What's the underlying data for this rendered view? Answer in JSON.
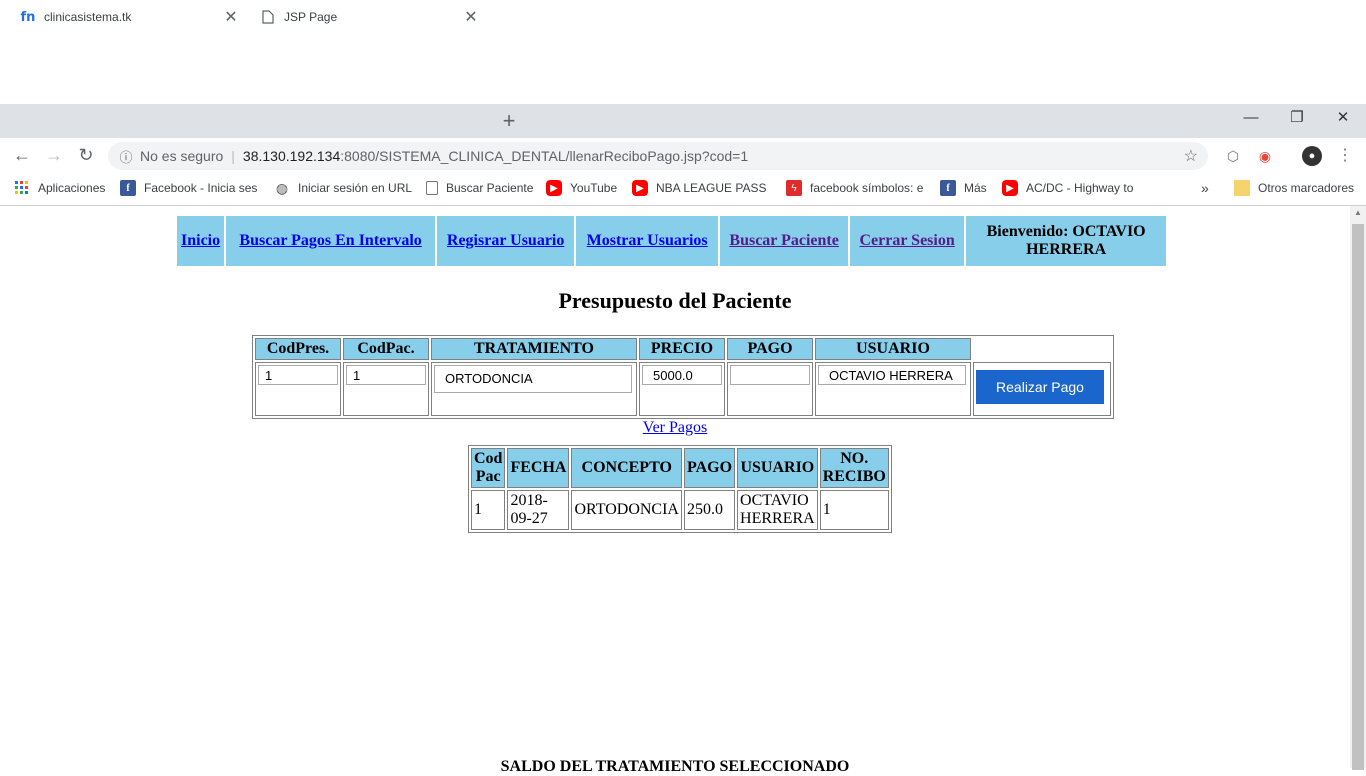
{
  "browser": {
    "tabs": [
      {
        "title": "clinicasistema.tk",
        "favicon": "fn"
      },
      {
        "title": "JSP Page"
      }
    ],
    "new_tab": "+",
    "window_controls": {
      "minimize": "—",
      "restore": "❐",
      "close": "✕"
    },
    "address": {
      "security_text": "No es seguro",
      "host": "38.130.192.134",
      "rest": ":8080/SISTEMA_CLINICA_DENTAL/llenarReciboPago.jsp?cod=1"
    },
    "bookmarks": [
      {
        "label": "Aplicaciones",
        "icon": "apps-grid-icon"
      },
      {
        "label": "Facebook - Inicia sesi",
        "icon": "facebook-icon"
      },
      {
        "label": "Iniciar sesión en URL",
        "icon": "globe-icon"
      },
      {
        "label": "Buscar Paciente",
        "icon": "page-icon"
      },
      {
        "label": "YouTube",
        "icon": "youtube-icon"
      },
      {
        "label": "NBA LEAGUE PASS H",
        "icon": "youtube-icon"
      },
      {
        "label": "facebook símbolos: e",
        "icon": "red-bolt-icon"
      },
      {
        "label": "Más",
        "icon": "facebook-icon"
      },
      {
        "label": "AC/DC - Highway to",
        "icon": "youtube-icon"
      }
    ],
    "bookmarks_more": "»",
    "other_bookmarks": "Otros marcadores"
  },
  "nav": {
    "inicio": "Inicio",
    "buscar_pagos": "Buscar Pagos En Intervalo",
    "registrar": "Regisrar Usuario",
    "mostrar": "Mostrar Usuarios",
    "buscar_paciente": "Buscar Paciente",
    "cerrar": "Cerrar Sesion",
    "welcome_line1": "Bienvenido: OCTAVIO",
    "welcome_line2": "HERRERA"
  },
  "heading": "Presupuesto del Paciente",
  "budget": {
    "headers": [
      "CodPres.",
      "CodPac.",
      "TRATAMIENTO",
      "PRECIO",
      "PAGO",
      "USUARIO"
    ],
    "row": {
      "codpres": "1",
      "codpac": "1",
      "tratamiento": "ORTODONCIA",
      "precio": "5000.0",
      "pago": "",
      "usuario": "OCTAVIO HERRERA"
    },
    "button": "Realizar Pago"
  },
  "ver_pagos": "Ver Pagos",
  "payments": {
    "headers": [
      {
        "l1": "Cod",
        "l2": "Pac"
      },
      {
        "l1": "FECHA",
        "l2": ""
      },
      {
        "l1": "CONCEPTO",
        "l2": ""
      },
      {
        "l1": "PAGO",
        "l2": ""
      },
      {
        "l1": "USUARIO",
        "l2": ""
      },
      {
        "l1": "NO.",
        "l2": "RECIBO"
      }
    ],
    "rows": [
      {
        "codpac": "1",
        "fecha_l1": "2018-",
        "fecha_l2": "09-27",
        "concepto": "ORTODONCIA",
        "pago": "250.0",
        "usuario_l1": "OCTAVIO",
        "usuario_l2": "HERRERA",
        "recibo": "1"
      }
    ]
  },
  "saldo": "SALDO DEL TRATAMIENTO SELECCIONADO"
}
